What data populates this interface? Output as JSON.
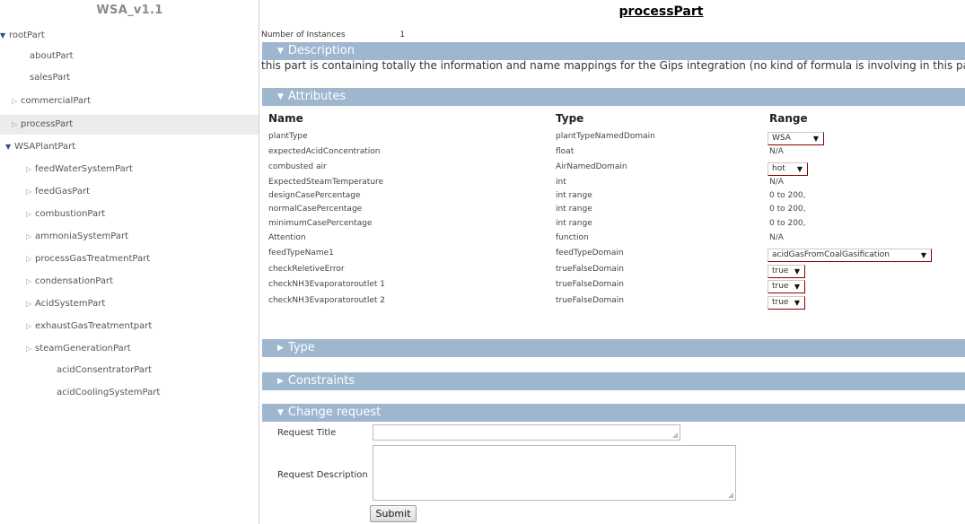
{
  "sidebar": {
    "title": "WSA_v1.1",
    "items": [
      {
        "label": "rootPart",
        "state": "open"
      },
      {
        "label": "aboutPart",
        "state": "leaf"
      },
      {
        "label": "salesPart",
        "state": "leaf"
      },
      {
        "label": "commercialPart",
        "state": "closed"
      },
      {
        "label": "processPart",
        "state": "closed",
        "selected": true
      },
      {
        "label": "WSAPlantPart",
        "state": "open"
      },
      {
        "label": "feedWaterSystemPart",
        "state": "closed"
      },
      {
        "label": "feedGasPart",
        "state": "closed"
      },
      {
        "label": "combustionPart",
        "state": "closed"
      },
      {
        "label": "ammoniaSystemPart",
        "state": "closed"
      },
      {
        "label": "processGasTreatmentPart",
        "state": "closed"
      },
      {
        "label": "condensationPart",
        "state": "closed"
      },
      {
        "label": "AcidSystemPart",
        "state": "closed"
      },
      {
        "label": "exhaustGasTreatmentpart",
        "state": "closed"
      },
      {
        "label": "steamGenerationPart",
        "state": "closed"
      },
      {
        "label": "acidConsentratorPart",
        "state": "leaf"
      },
      {
        "label": "acidCoolingSystemPart",
        "state": "leaf"
      }
    ]
  },
  "main": {
    "title": "processPart",
    "instances_label": "Number of Instances",
    "instances_value": "1",
    "sections": {
      "description": "Description",
      "attributes": "Attributes",
      "type": "Type",
      "constraints": "Constraints",
      "change_request": "Change request"
    },
    "description_text": "this part is containing totally the information and name mappings for the Gips integration (no kind of formula is involving in this pa",
    "description_cut": "r",
    "attr_headers": {
      "name": "Name",
      "type": "Type",
      "range": "Range"
    },
    "attributes": [
      {
        "name": "plantType",
        "type": "plantTypeNamedDomain",
        "range": "WSA",
        "select": true
      },
      {
        "name": "expectedAcidConcentration",
        "type": "float",
        "range": "N/A",
        "select": false
      },
      {
        "name": "combusted air",
        "type": "AirNamedDomain",
        "range": "hot",
        "select": true
      },
      {
        "name": "ExpectedSteamTemperature",
        "type": "int",
        "range": "N/A",
        "select": false
      },
      {
        "name": "designCasePercentage",
        "type": "int range",
        "range": "0 to 200,",
        "select": false
      },
      {
        "name": "normalCasePercentage",
        "type": "int range",
        "range": "0 to 200,",
        "select": false
      },
      {
        "name": "minimumCasePercentage",
        "type": "int range",
        "range": "0 to 200,",
        "select": false
      },
      {
        "name": "Attention",
        "type": "function",
        "range": "N/A",
        "select": false
      },
      {
        "name": "feedTypeName1",
        "type": "feedTypeDomain",
        "range": "acidGasFromCoalGasification",
        "select": true
      },
      {
        "name": "checkReletiveError",
        "type": "trueFalseDomain",
        "range": "true",
        "select": true
      },
      {
        "name": "checkNH3Evaporatoroutlet 1",
        "type": "trueFalseDomain",
        "range": "true",
        "select": true
      },
      {
        "name": "checkNH3Evaporatoroutlet 2",
        "type": "trueFalseDomain",
        "range": "true",
        "select": true
      }
    ],
    "form": {
      "request_title_label": "Request Title",
      "request_title_value": "",
      "request_description_label": "Request Description",
      "request_description_value": "",
      "submit_label": "Submit"
    }
  },
  "colors": {
    "section_bar": "#9fb6cf",
    "select_border": "#8b0000",
    "tree_open_arrow": "#33507a"
  }
}
